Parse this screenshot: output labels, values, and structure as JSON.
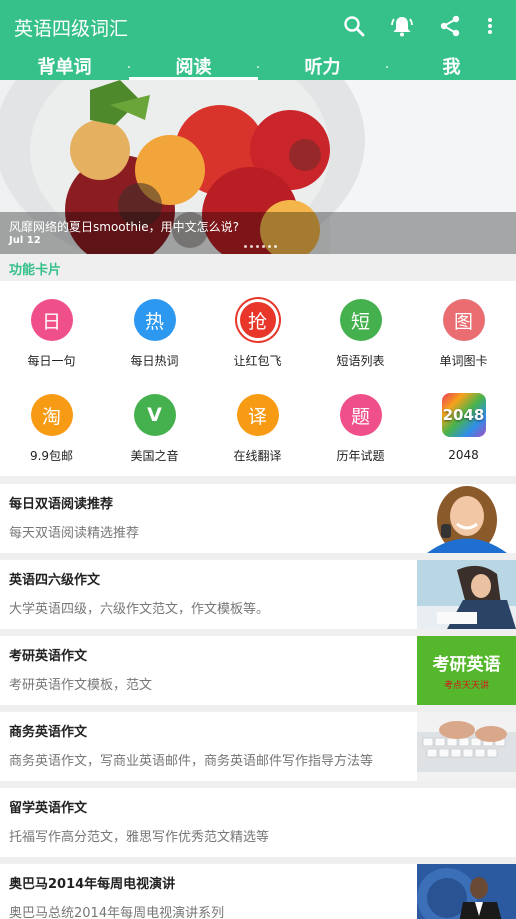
{
  "app": {
    "title": "英语四级词汇"
  },
  "actions": [
    {
      "name": "search-icon"
    },
    {
      "name": "alarm-icon"
    },
    {
      "name": "share-icon"
    },
    {
      "name": "more-vert-icon"
    }
  ],
  "tabs": [
    {
      "label": "背单词"
    },
    {
      "label": "阅读"
    },
    {
      "label": "听力"
    },
    {
      "label": "我"
    }
  ],
  "banner": {
    "title": "风靡网络的夏日smoothie，用中文怎么说?",
    "date": "Jul 12"
  },
  "section": {
    "label": "功能卡片"
  },
  "cards": [
    {
      "glyph": "日",
      "label": "每日一句",
      "color": "#f0508a"
    },
    {
      "glyph": "热",
      "label": "每日热词",
      "color": "#2c98f0"
    },
    {
      "glyph": "抢",
      "label": "让红包飞",
      "color": "#e9362b"
    },
    {
      "glyph": "短",
      "label": "短语列表",
      "color": "#45b14e"
    },
    {
      "glyph": "图",
      "label": "单词图卡",
      "color": "#ea6d72"
    },
    {
      "glyph": "淘",
      "label": "9.9包邮",
      "color": "#f79a14"
    },
    {
      "glyph": "V",
      "label": "美国之音",
      "color": "#45b14e"
    },
    {
      "glyph": "译",
      "label": "在线翻译",
      "color": "#f79a14"
    },
    {
      "glyph": "题",
      "label": "历年试题",
      "color": "#f0508a"
    },
    {
      "glyph": "2048",
      "label": "2048",
      "color": "#ffffff"
    }
  ],
  "list": [
    {
      "title": "每日双语阅读推荐",
      "desc": "每天双语阅读精选推荐"
    },
    {
      "title": "英语四六级作文",
      "desc": "大学英语四级，六级作文范文，作文模板等。"
    },
    {
      "title": "考研英语作文",
      "desc": "考研英语作文模板，范文",
      "thumb_text": "考研英语",
      "thumb_sub": "考点天天讲"
    },
    {
      "title": "商务英语作文",
      "desc": "商务英语作文，写商业英语邮件，商务英语邮件写作指导方法等"
    },
    {
      "title": "留学英语作文",
      "desc": "托福写作高分范文，雅思写作优秀范文精选等"
    },
    {
      "title": "奥巴马2014年每周电视演讲",
      "desc": "奥巴马总统2014年每周电视演讲系列"
    }
  ],
  "colors": {
    "primary": "#36c08a",
    "background": "#efefef"
  }
}
